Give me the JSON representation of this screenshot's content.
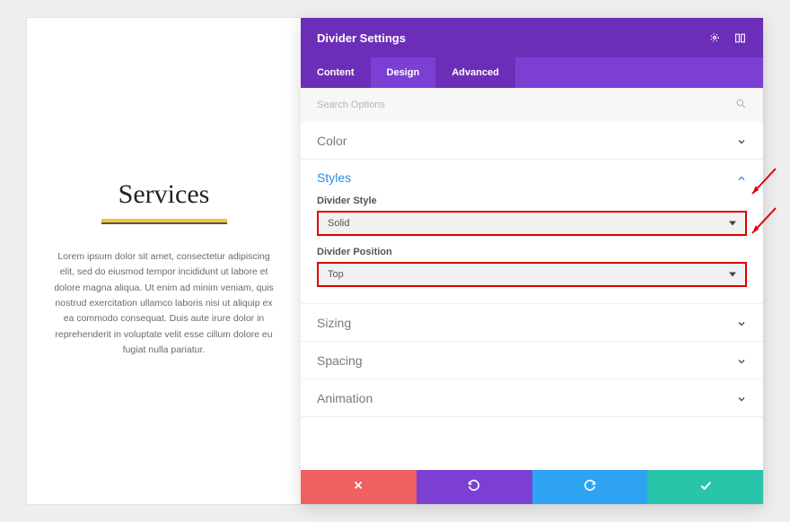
{
  "preview": {
    "title": "Services",
    "body": "Lorem ipsum dolor sit amet, consectetur adipiscing elit, sed do eiusmod tempor incididunt ut labore et dolore magna aliqua. Ut enim ad minim veniam, quis nostrud exercitation ullamco laboris nisi ut aliquip ex ea commodo consequat. Duis aute irure dolor in reprehenderit in voluptate velit esse cillum dolore eu fugiat nulla pariatur."
  },
  "panel": {
    "title": "Divider Settings",
    "tabs": {
      "content": "Content",
      "design": "Design",
      "advanced": "Advanced"
    },
    "search_placeholder": "Search Options",
    "sections": {
      "color": "Color",
      "styles": "Styles",
      "sizing": "Sizing",
      "spacing": "Spacing",
      "animation": "Animation"
    },
    "styles": {
      "divider_style_label": "Divider Style",
      "divider_style_value": "Solid",
      "divider_position_label": "Divider Position",
      "divider_position_value": "Top"
    }
  }
}
